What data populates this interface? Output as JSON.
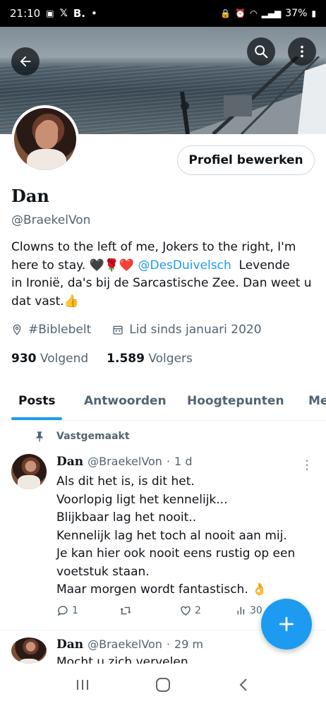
{
  "status_bar": {
    "time": "21:10",
    "carrier_mark": "B.",
    "dot": "•",
    "battery": "37%"
  },
  "profile": {
    "name": "Dan",
    "handle": "@BraekelVon",
    "edit_label": "Profiel bewerken",
    "bio": {
      "line1": "Clowns to the left of me, Jokers to the right, I'm",
      "line2_prefix": "here to stay. ",
      "line2_emoji": "🖤🌹❤️",
      "mention": "@DesDuivelsch",
      "line2_suffix": "  Levende",
      "line3": "in Ironië, da's bij de Sarcastische Zee. Dan weet u",
      "line4": "dat vast.👍"
    },
    "location": "#Biblebelt",
    "joined": "Lid sinds januari 2020",
    "following_count": "930",
    "following_label": "Volgend",
    "followers_count": "1.589",
    "followers_label": "Volgers"
  },
  "tabs": [
    {
      "label": "Posts",
      "active": true
    },
    {
      "label": "Antwoorden",
      "active": false
    },
    {
      "label": "Hoogtepunten",
      "active": false
    },
    {
      "label": "Me",
      "active": false
    }
  ],
  "pinned_label": "Vastgemaakt",
  "posts": [
    {
      "name": "Dan",
      "handle": "@BraekelVon",
      "separator": "·",
      "time": "1 d",
      "lines": [
        "Als dit het is, is dit het.",
        "Voorlopig ligt het kennelijk...",
        "Blijkbaar lag het nooit..",
        "Kennelijk lag het toch al nooit aan mij.",
        "Je kan hier ook nooit eens rustig op een",
        "voetstuk staan.",
        "Maar morgen wordt fantastisch. 👌"
      ],
      "replies": "1",
      "reposts": "",
      "likes": "2",
      "views": "30"
    },
    {
      "name": "Dan",
      "handle": "@BraekelVon",
      "separator": "·",
      "time": "29 m",
      "first_line": "Mocht u zich vervelen"
    }
  ],
  "colors": {
    "accent": "#1d9bf0",
    "text": "#0f1419",
    "muted": "#536471"
  }
}
